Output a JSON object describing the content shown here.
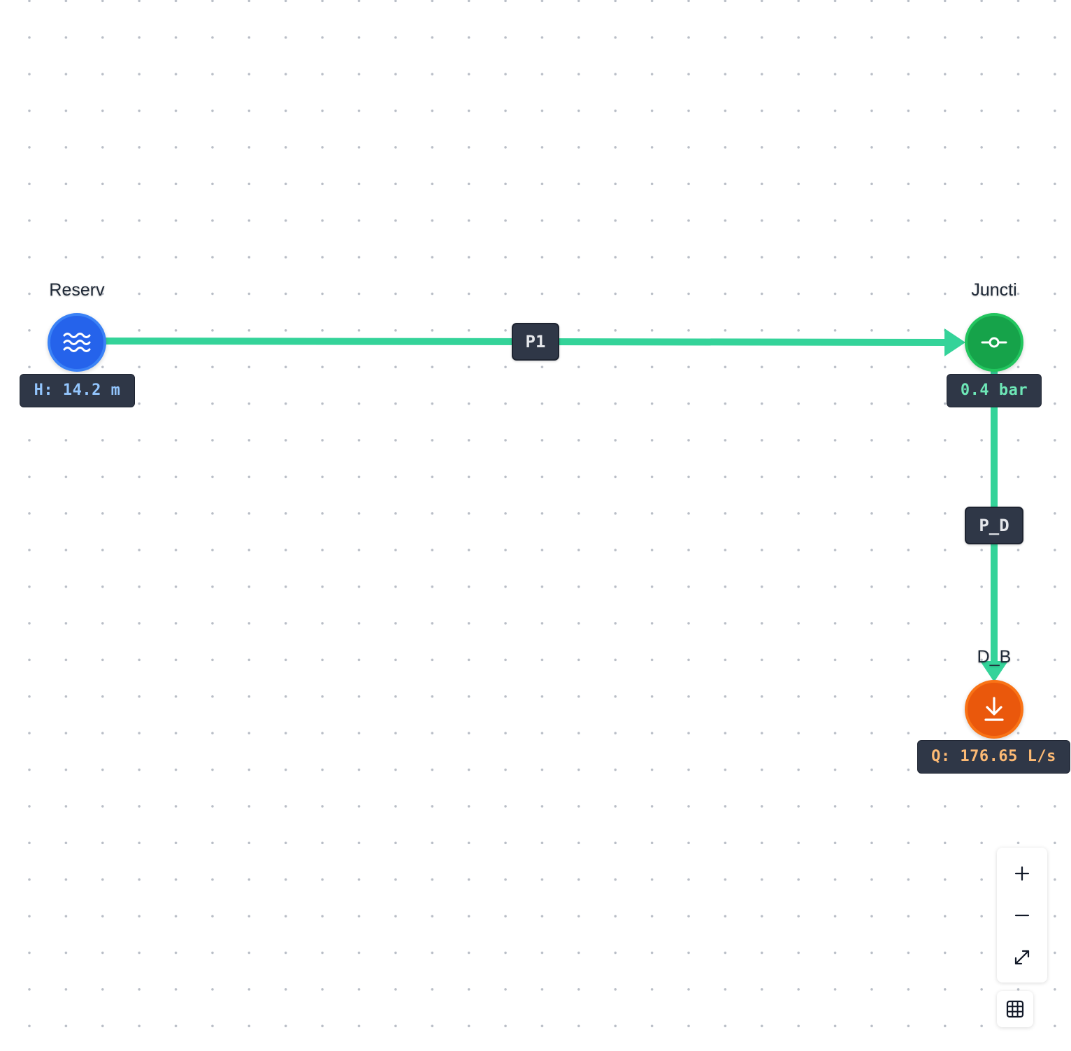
{
  "colors": {
    "pipe": "#34d399",
    "reservoir": "#2563eb",
    "junction": "#16a34a",
    "demand": "#ea580c",
    "head_text": "#93c5fd",
    "pressure_text": "#6ee7b7",
    "flow_text": "#fdba74",
    "badge_bg": "#2f3747"
  },
  "nodes": {
    "reservoir": {
      "label": "Reserv",
      "badge": "H: 14.2 m",
      "icon": "water-waves-icon"
    },
    "junction": {
      "label": "Juncti",
      "badge": "0.4 bar",
      "icon": "junction-icon"
    },
    "demand": {
      "label": "D_B",
      "badge": "Q: 176.65 L/s",
      "icon": "download-arrow-icon"
    }
  },
  "edges": {
    "p1": {
      "label": "P1",
      "from": "Reserv",
      "to": "Juncti"
    },
    "p_d": {
      "label": "P_D",
      "from": "Juncti",
      "to": "D_B"
    }
  },
  "controls": {
    "zoom_in": "plus-icon",
    "zoom_out": "minus-icon",
    "fit_view": "expand-icon",
    "table": "grid-table-icon"
  }
}
